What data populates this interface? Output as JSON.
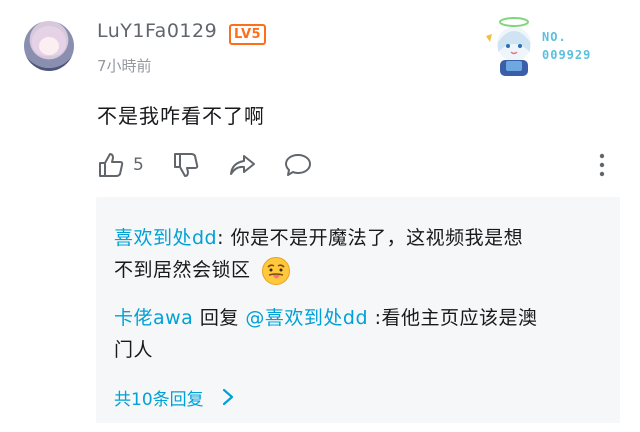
{
  "comment": {
    "username": "LuY1Fa0129",
    "level_badge": "LV5",
    "time": "7小時前",
    "text": "不是我咋看不了啊",
    "like_count": "5",
    "fan_badge": {
      "label": "NO.",
      "number": "009929"
    }
  },
  "replies": [
    {
      "author": "喜欢到处dd",
      "separator": ": ",
      "text_line1": "你是不是开魔法了，这视频我是想",
      "text_line2": "不到居然会锁区",
      "emoji": "tongue-face-emoji"
    },
    {
      "author": "卡佬awa",
      "reply_word": " 回复 ",
      "mention": "@喜欢到处dd",
      "text_line1": " :看他主页应该是澳",
      "text_line2": "门人"
    }
  ],
  "more_replies_label": "共10条回复",
  "colors": {
    "link_blue": "#00a1d6",
    "level_orange": "#ff6f1a",
    "gray_text": "#61666d",
    "reply_bg": "#f6f7f8"
  },
  "icons": [
    "like-icon",
    "dislike-icon",
    "share-icon",
    "reply-icon",
    "more-vertical-icon",
    "chevron-right-icon"
  ]
}
